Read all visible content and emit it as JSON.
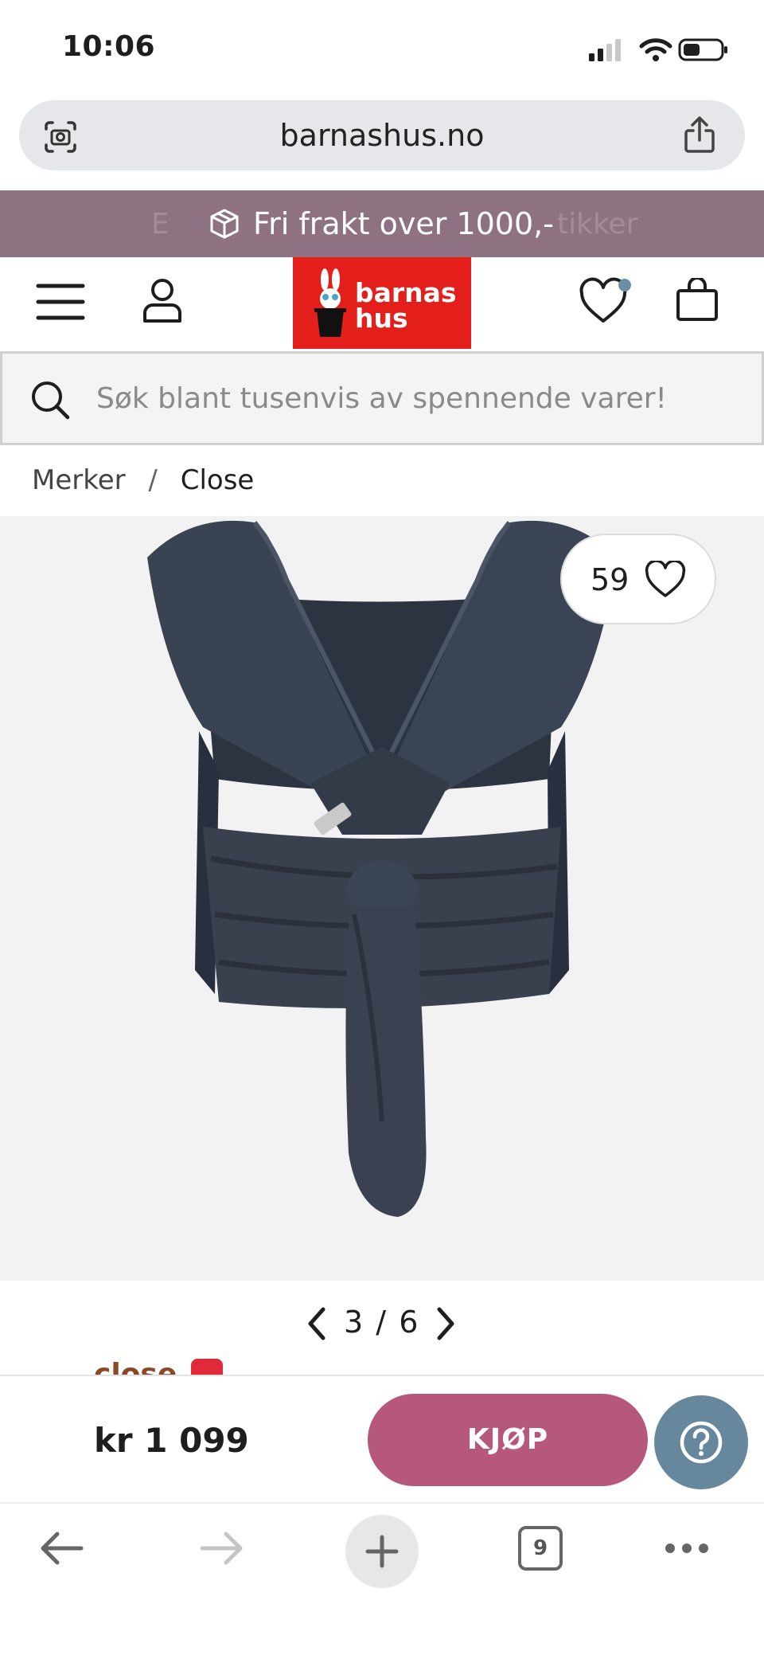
{
  "status_bar": {
    "time": "10:06"
  },
  "browser": {
    "url": "barnashus.no",
    "tab_count": "9"
  },
  "promo": {
    "text": "Fri frakt over 1000,-",
    "ghost_left": "E",
    "ghost_right": "tikker"
  },
  "header": {
    "logo_line1": "barnas",
    "logo_line2": "hus"
  },
  "search": {
    "placeholder": "Søk blant tusenvis av spennende varer!"
  },
  "breadcrumb": {
    "parent": "Merker",
    "separator": "/",
    "current": "Close"
  },
  "product": {
    "favorites_count": "59",
    "image_index": "3",
    "image_total": "6",
    "pager_separator": "/",
    "brand_peek": "close",
    "price": "kr 1 099",
    "buy_label": "KJØP"
  },
  "colors": {
    "promo_bg": "#8f7282",
    "logo_red": "#e31e1b",
    "buy_button": "#b5587b",
    "help_button": "#67889c"
  }
}
